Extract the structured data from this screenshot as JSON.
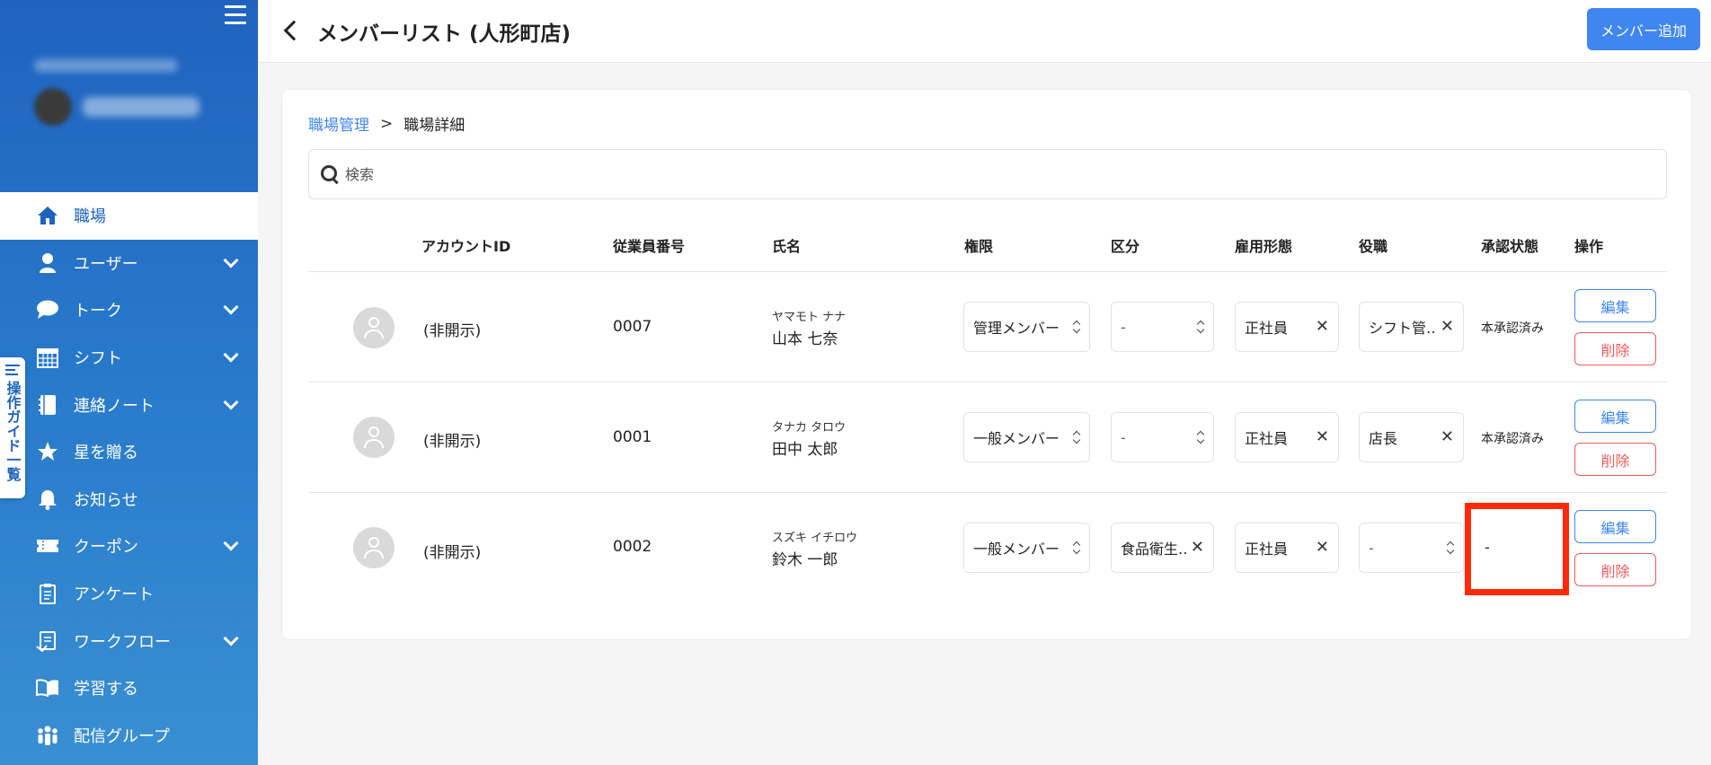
{
  "sidebar": {
    "nav": [
      {
        "label": "職場",
        "icon": "home-icon",
        "active": true,
        "expandable": false
      },
      {
        "label": "ユーザー",
        "icon": "user-icon",
        "active": false,
        "expandable": true
      },
      {
        "label": "トーク",
        "icon": "chat-bubble-icon",
        "active": false,
        "expandable": true
      },
      {
        "label": "シフト",
        "icon": "calendar-icon",
        "active": false,
        "expandable": true
      },
      {
        "label": "連絡ノート",
        "icon": "notebook-icon",
        "active": false,
        "expandable": true
      },
      {
        "label": "星を贈る",
        "icon": "star-icon",
        "active": false,
        "expandable": false
      },
      {
        "label": "お知らせ",
        "icon": "bell-icon",
        "active": false,
        "expandable": false
      },
      {
        "label": "クーポン",
        "icon": "ticket-icon",
        "active": false,
        "expandable": true
      },
      {
        "label": "アンケート",
        "icon": "clipboard-icon",
        "active": false,
        "expandable": false
      },
      {
        "label": "ワークフロー",
        "icon": "workflow-icon",
        "active": false,
        "expandable": true
      },
      {
        "label": "学習する",
        "icon": "book-icon",
        "active": false,
        "expandable": false
      },
      {
        "label": "配信グループ",
        "icon": "group-icon",
        "active": false,
        "expandable": false
      }
    ],
    "guide_tab": "操作ガイド一覧"
  },
  "header": {
    "title": "メンバーリスト (人形町店)",
    "add_button": "メンバー追加"
  },
  "breadcrumb": {
    "parent": "職場管理",
    "separator": ">",
    "current": "職場詳細"
  },
  "search": {
    "placeholder": "検索"
  },
  "table": {
    "headers": {
      "account_id": "アカウントID",
      "employee_no": "従業員番号",
      "name": "氏名",
      "permission": "権限",
      "category": "区分",
      "employment": "雇用形態",
      "position": "役職",
      "approval": "承認状態",
      "actions": "操作"
    },
    "edit_label": "編集",
    "delete_label": "削除",
    "rows": [
      {
        "account_id": "(非開示)",
        "employee_no": "0007",
        "kana": "ヤマモト ナナ",
        "name": "山本 七奈",
        "permission": "管理メンバー",
        "category": "-",
        "employment": "正社員",
        "position": "シフト管‥",
        "approval": "本承認済み"
      },
      {
        "account_id": "(非開示)",
        "employee_no": "0001",
        "kana": "タナカ タロウ",
        "name": "田中 太郎",
        "permission": "一般メンバー",
        "category": "-",
        "employment": "正社員",
        "position": "店長",
        "approval": "本承認済み"
      },
      {
        "account_id": "(非開示)",
        "employee_no": "0002",
        "kana": "スズキ イチロウ",
        "name": "鈴木 一郎",
        "permission": "一般メンバー",
        "category": "食品衛生‥",
        "employment": "正社員",
        "position": "-",
        "approval": "-"
      }
    ]
  },
  "colors": {
    "sidebar": "#1f63bf",
    "accent": "#3f86f0",
    "danger": "#f05a5a",
    "highlight": "#ff2a0a"
  }
}
